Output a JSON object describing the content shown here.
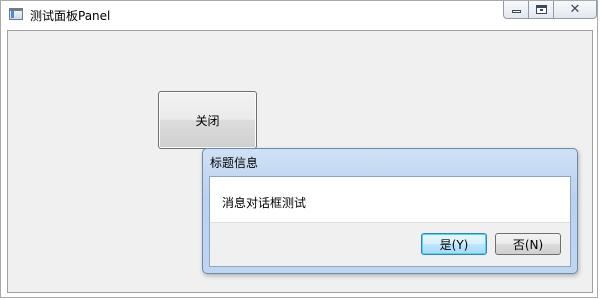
{
  "window": {
    "title": "测试面板Panel",
    "controls": {
      "minimize_icon": "minimize-icon",
      "maximize_icon": "maximize-icon",
      "close_icon": "close-icon"
    }
  },
  "panel": {
    "close_button_label": "关闭"
  },
  "dialog": {
    "title": "标题信息",
    "message": "消息对话框测试",
    "yes_label": "是(Y)",
    "no_label": "否(N)"
  },
  "colors": {
    "panel_bg": "#f0f0f0",
    "dialog_frame": "#b9d2ee",
    "default_button_border": "#3c7fb1"
  }
}
